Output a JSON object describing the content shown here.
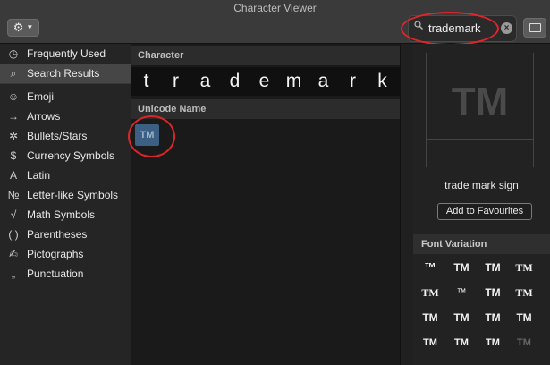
{
  "window": {
    "title": "Character Viewer"
  },
  "toolbar": {
    "gear_icon": "gear-icon",
    "search_value": "trademark"
  },
  "sidebar": {
    "items": [
      {
        "label": "Frequently Used",
        "icon": "◷",
        "selected": false
      },
      {
        "label": "Search Results",
        "icon": "⌕",
        "selected": true
      },
      {
        "label": "Emoji",
        "icon": "☺",
        "selected": false
      },
      {
        "label": "Arrows",
        "icon": "→",
        "selected": false
      },
      {
        "label": "Bullets/Stars",
        "icon": "✲",
        "selected": false
      },
      {
        "label": "Currency Symbols",
        "icon": "$",
        "selected": false
      },
      {
        "label": "Latin",
        "icon": "A",
        "selected": false
      },
      {
        "label": "Letter-like Symbols",
        "icon": "№",
        "selected": false
      },
      {
        "label": "Math Symbols",
        "icon": "√",
        "selected": false
      },
      {
        "label": "Parentheses",
        "icon": "( )",
        "selected": false
      },
      {
        "label": "Pictographs",
        "icon": "✍",
        "selected": false
      },
      {
        "label": "Punctuation",
        "icon": "„",
        "selected": false
      }
    ]
  },
  "results": {
    "character_header": "Character",
    "characters": [
      "t",
      "r",
      "a",
      "d",
      "e",
      "m",
      "a",
      "r",
      "k"
    ],
    "unicode_header": "Unicode Name",
    "tile_glyph": "TM"
  },
  "detail": {
    "glyph": "TM",
    "name": "trade mark sign",
    "add_button": "Add to Favourites",
    "font_variation_header": "Font Variation",
    "variations": [
      "™",
      "TM",
      "TM",
      "TM",
      "TM",
      "™",
      "TM",
      "TM",
      "TM",
      "TM",
      "TM",
      "TM",
      "TM",
      "TM",
      "TM",
      "TM"
    ]
  },
  "colors": {
    "selection": "#3c5f84",
    "annotation": "#e0262b"
  }
}
